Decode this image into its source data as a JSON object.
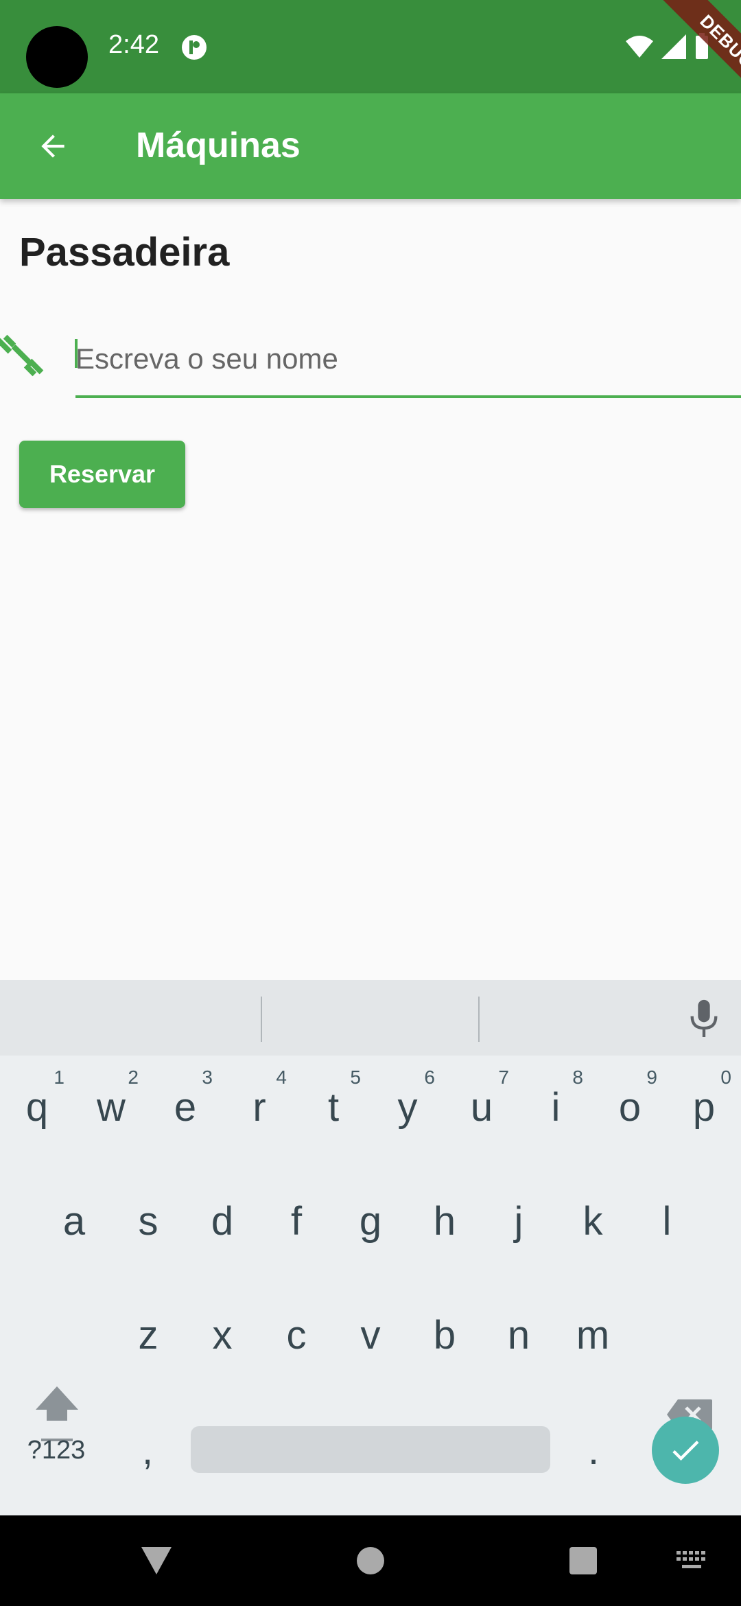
{
  "status_bar": {
    "time": "2:42",
    "debug_label": "DEBUG"
  },
  "app_bar": {
    "title": "Máquinas"
  },
  "content": {
    "machine_name": "Passadeira",
    "name_field": {
      "placeholder": "Escreva o seu nome",
      "value": ""
    },
    "reserve_label": "Reservar"
  },
  "keyboard": {
    "row1": [
      {
        "k": "q",
        "h": "1"
      },
      {
        "k": "w",
        "h": "2"
      },
      {
        "k": "e",
        "h": "3"
      },
      {
        "k": "r",
        "h": "4"
      },
      {
        "k": "t",
        "h": "5"
      },
      {
        "k": "y",
        "h": "6"
      },
      {
        "k": "u",
        "h": "7"
      },
      {
        "k": "i",
        "h": "8"
      },
      {
        "k": "o",
        "h": "9"
      },
      {
        "k": "p",
        "h": "0"
      }
    ],
    "row2": [
      "a",
      "s",
      "d",
      "f",
      "g",
      "h",
      "j",
      "k",
      "l"
    ],
    "row3": [
      "z",
      "x",
      "c",
      "v",
      "b",
      "n",
      "m"
    ],
    "symbols_label": "?123",
    "comma": ",",
    "period": "."
  },
  "colors": {
    "status_bar": "#388e3c",
    "app_bar": "#4caf50",
    "accent": "#4caf50",
    "enter_key": "#4db6ac"
  }
}
